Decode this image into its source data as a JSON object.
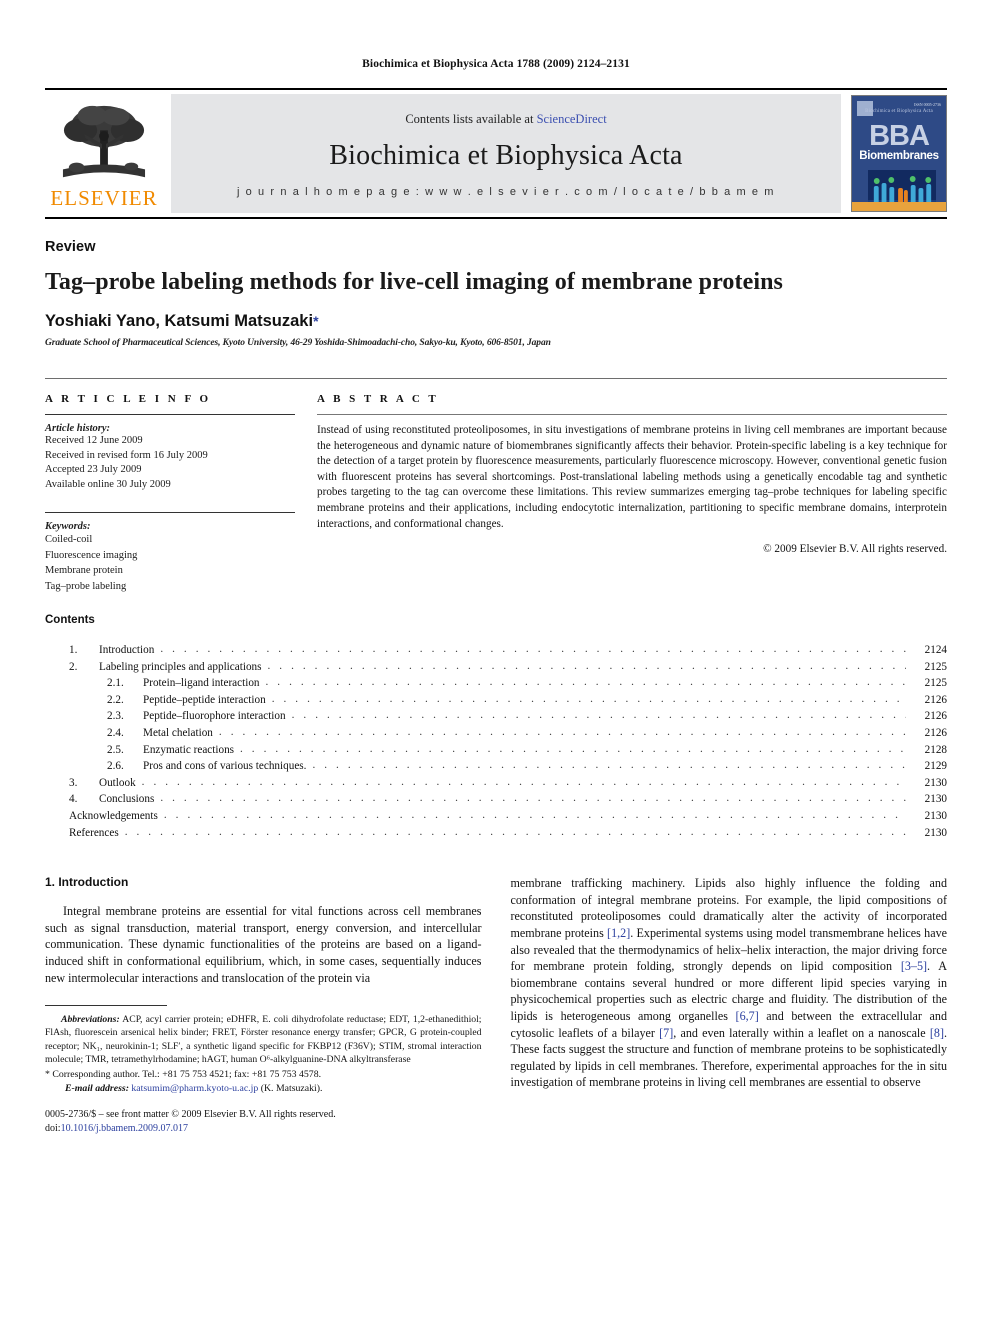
{
  "running_head": "Biochimica et Biophysica Acta 1788 (2009) 2124–2131",
  "masthead": {
    "publisher": "ELSEVIER",
    "contents_prefix": "Contents lists available at ",
    "contents_link": "ScienceDirect",
    "journal_title": "Biochimica et Biophysica Acta",
    "homepage": "j o u r n a l   h o m e p a g e :   w w w . e l s e v i e r . c o m / l o c a t e / b b a m e m",
    "cover": {
      "badge_label": "",
      "issn": "ISSN 0005-2736",
      "top_caption": "Biochimica et Biophysica Acta",
      "acronym": "BBA",
      "subtitle": "Biomembranes"
    }
  },
  "title_block": {
    "doctype": "Review",
    "title": "Tag–probe labeling methods for live-cell imaging of membrane proteins",
    "authors": "Yoshiaki Yano, Katsumi Matsuzaki",
    "corresponding_marker": "*",
    "affiliation": "Graduate School of Pharmaceutical Sciences, Kyoto University, 46-29 Yoshida-Shimoadachi-cho, Sakyo-ku, Kyoto, 606-8501, Japan"
  },
  "article_info": {
    "heading": "A R T I C L E   I N F O",
    "history_label": "Article history:",
    "history": [
      "Received 12 June 2009",
      "Received in revised form 16 July 2009",
      "Accepted 23 July 2009",
      "Available online 30 July 2009"
    ],
    "keywords_label": "Keywords:",
    "keywords": [
      "Coiled-coil",
      "Fluorescence imaging",
      "Membrane protein",
      "Tag–probe labeling"
    ]
  },
  "abstract": {
    "heading": "A B S T R A C T",
    "text": "Instead of using reconstituted proteoliposomes, in situ investigations of membrane proteins in living cell membranes are important because the heterogeneous and dynamic nature of biomembranes significantly affects their behavior. Protein-specific labeling is a key technique for the detection of a target protein by fluorescence measurements, particularly fluorescence microscopy. However, conventional genetic fusion with fluorescent proteins has several shortcomings. Post-translational labeling methods using a genetically encodable tag and synthetic probes targeting to the tag can overcome these limitations. This review summarizes emerging tag–probe techniques for labeling specific membrane proteins and their applications, including endocytotic internalization, partitioning to specific membrane domains, interprotein interactions, and conformational changes.",
    "copyright": "© 2009 Elsevier B.V. All rights reserved."
  },
  "contents": {
    "title": "Contents",
    "entries": [
      {
        "num": "1.",
        "level": 1,
        "label": "Introduction",
        "page": "2124"
      },
      {
        "num": "2.",
        "level": 1,
        "label": "Labeling principles and applications",
        "page": "2125"
      },
      {
        "num": "2.1.",
        "level": 2,
        "label": "Protein–ligand interaction",
        "page": "2125"
      },
      {
        "num": "2.2.",
        "level": 2,
        "label": "Peptide–peptide interaction",
        "page": "2126"
      },
      {
        "num": "2.3.",
        "level": 2,
        "label": "Peptide–fluorophore interaction",
        "page": "2126"
      },
      {
        "num": "2.4.",
        "level": 2,
        "label": "Metal chelation",
        "page": "2126"
      },
      {
        "num": "2.5.",
        "level": 2,
        "label": "Enzymatic reactions",
        "page": "2128"
      },
      {
        "num": "2.6.",
        "level": 2,
        "label": "Pros and cons of various techniques.",
        "page": "2129"
      },
      {
        "num": "3.",
        "level": 1,
        "label": "Outlook",
        "page": "2130"
      },
      {
        "num": "4.",
        "level": 1,
        "label": "Conclusions",
        "page": "2130"
      },
      {
        "num": "",
        "level": 0,
        "label": "Acknowledgements",
        "page": "2130"
      },
      {
        "num": "",
        "level": 0,
        "label": "References",
        "page": "2130"
      }
    ]
  },
  "body": {
    "section_heading": "1. Introduction",
    "left_paragraph": "Integral membrane proteins are essential for vital functions across cell membranes such as signal transduction, material transport, energy conversion, and intercellular communication. These dynamic functionalities of the proteins are based on a ligand-induced shift in conformational equilibrium, which, in some cases, sequentially induces new intermolecular interactions and translocation of the protein via",
    "right_parts": {
      "p1": "membrane trafficking machinery. Lipids also highly influence the folding and conformation of integral membrane proteins. For example, the lipid compositions of reconstituted proteoliposomes could dramatically alter the activity of incorporated membrane proteins ",
      "ref1": "[1,2]",
      "p2": ". Experimental systems using model transmembrane helices have also revealed that the thermodynamics of helix–helix interaction, the major driving force for membrane protein folding, strongly depends on lipid composition ",
      "ref2": "[3–5]",
      "p3": ". A biomembrane contains several hundred or more different lipid species varying in physicochemical properties such as electric charge and fluidity. The distribution of the lipids is heterogeneous among organelles ",
      "ref3": "[6,7]",
      "p4": " and between the extracellular and cytosolic leaflets of a bilayer ",
      "ref4": "[7]",
      "p5": ", and even laterally within a leaflet on a nanoscale ",
      "ref5": "[8]",
      "p6": ". These facts suggest the structure and function of membrane proteins to be sophisticatedly regulated by lipids in cell membranes. Therefore, experimental approaches for the in situ investigation of membrane proteins in living cell membranes are essential to observe"
    }
  },
  "footnotes": {
    "abbrev_label": "Abbreviations:",
    "abbrev_text": " ACP, acyl carrier protein; eDHFR, E. coli dihydrofolate reductase; EDT, 1,2-ethanedithiol; FlAsh, fluorescein arsenical helix binder; FRET, Förster resonance energy transfer; GPCR, G protein-coupled receptor; NK₁, neurokinin-1; SLF′, a synthetic ligand specific for FKBP12 (F36V); STIM, stromal interaction molecule; TMR, tetramethylrhodamine; hAGT, human O⁶-alkylguanine-DNA alkyltransferase",
    "corresponding": "* Corresponding author. Tel.: +81 75 753 4521; fax: +81 75 753 4578.",
    "email_label": "E-mail address:",
    "email": "katsumim@pharm.kyoto-u.ac.jp",
    "email_owner": "(K. Matsuzaki).",
    "imprint_line1": "0005-2736/$ – see front matter © 2009 Elsevier B.V. All rights reserved.",
    "doi_prefix": "doi:",
    "doi": "10.1016/j.bbamem.2009.07.017"
  }
}
